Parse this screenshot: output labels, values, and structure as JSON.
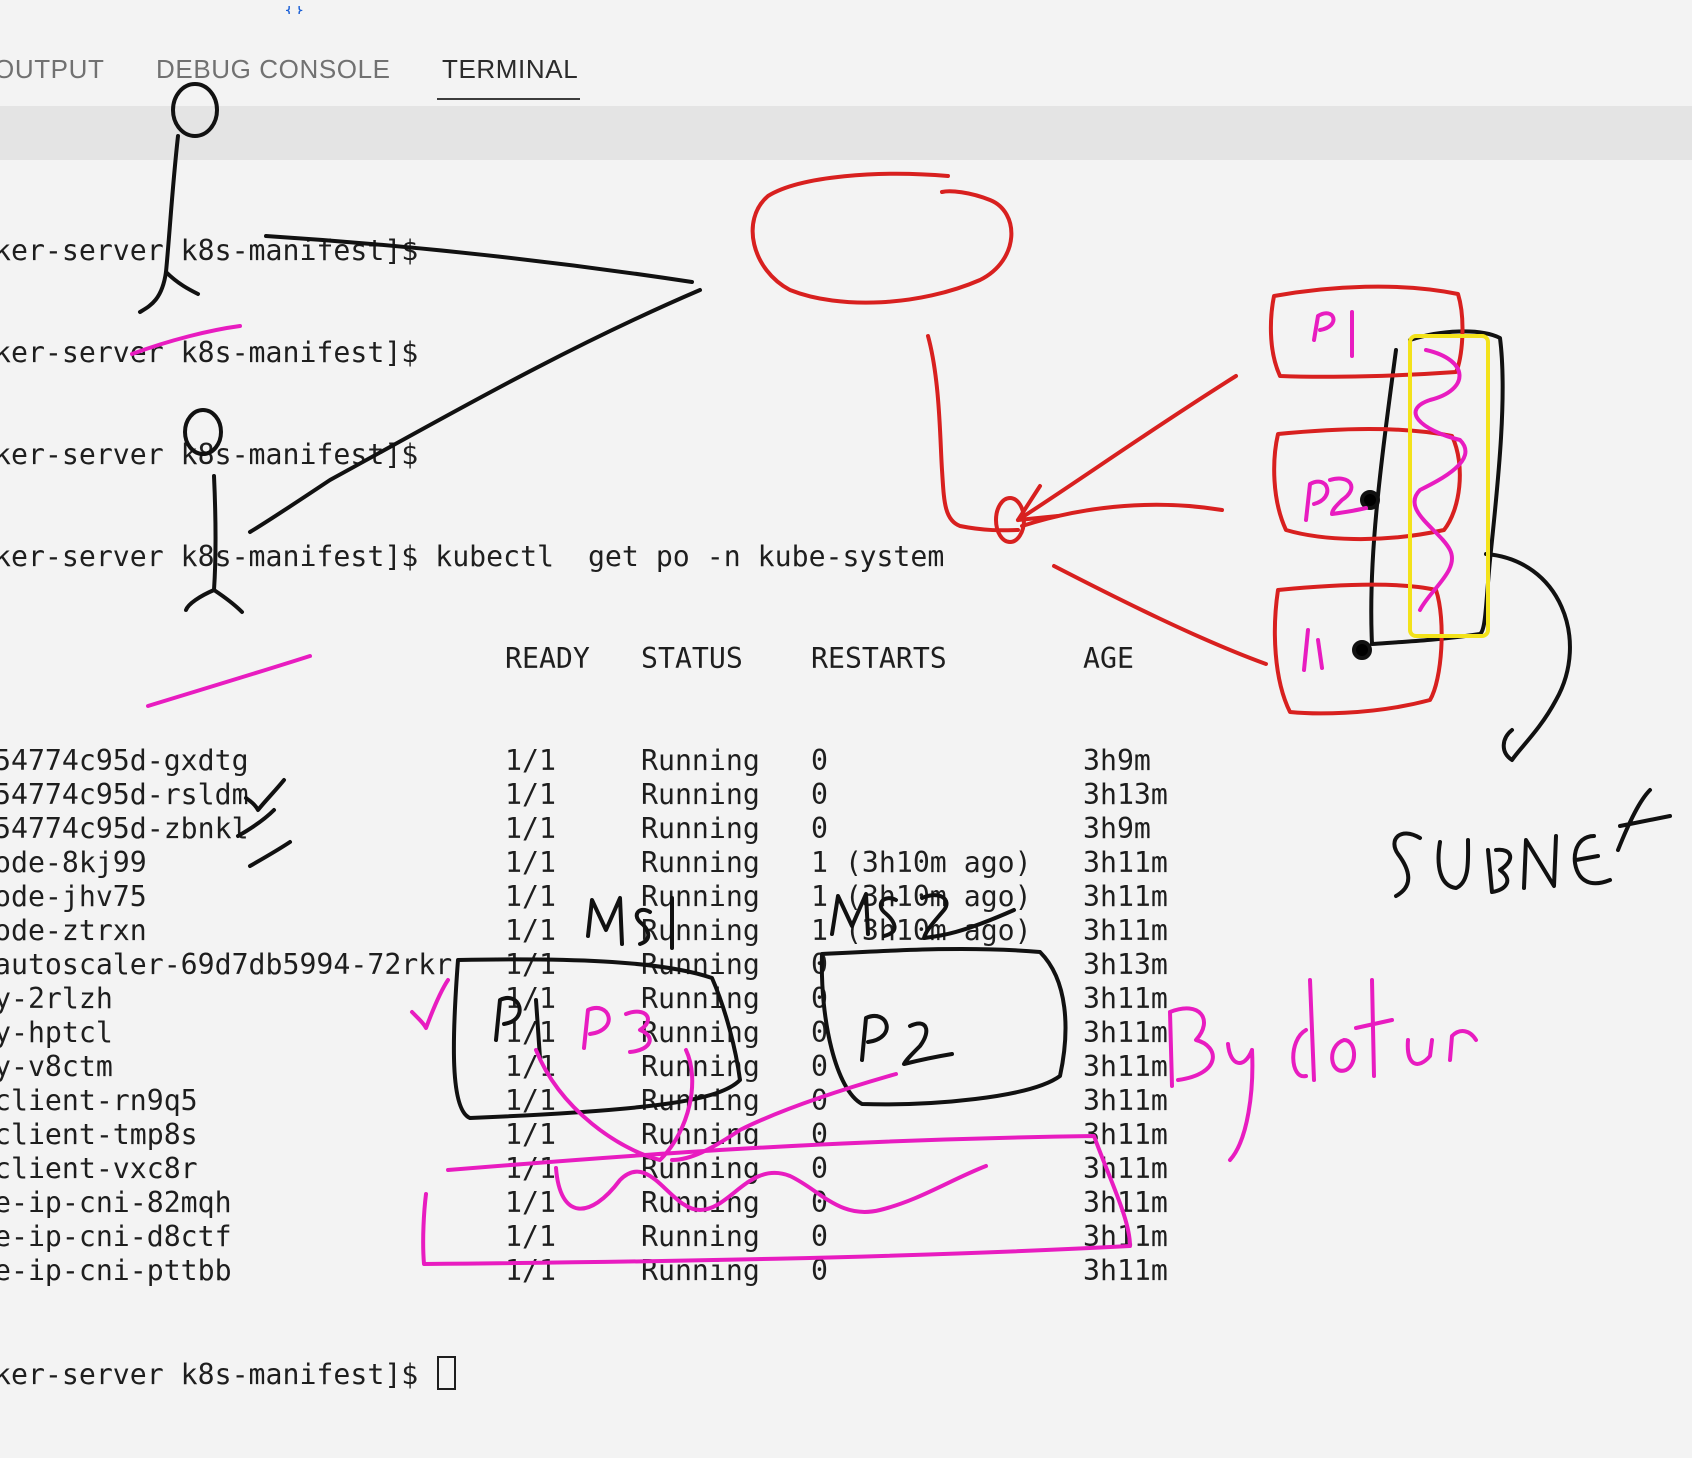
{
  "tabs": [
    {
      "label": "OUTPUT"
    },
    {
      "label": "DEBUG CONSOLE"
    },
    {
      "label": "TERMINAL",
      "active": true
    }
  ],
  "terminal": {
    "prompt_lines": [
      "ker-server k8s-manifest]$",
      "ker-server k8s-manifest]$",
      "ker-server k8s-manifest]$"
    ],
    "command_line": "ker-server k8s-manifest]$ kubectl  get po -n kube-system",
    "headers": {
      "ready": "READY",
      "status": "STATUS",
      "restarts": "RESTARTS",
      "age": "AGE"
    },
    "rows": [
      {
        "name": "54774c95d-gxdtg",
        "ready": "1/1",
        "status": "Running",
        "restarts": "0",
        "age": "3h9m"
      },
      {
        "name": "54774c95d-rsldm",
        "ready": "1/1",
        "status": "Running",
        "restarts": "0",
        "age": "3h13m"
      },
      {
        "name": "54774c95d-zbnkl",
        "ready": "1/1",
        "status": "Running",
        "restarts": "0",
        "age": "3h9m"
      },
      {
        "name": "ode-8kj99",
        "ready": "1/1",
        "status": "Running",
        "restarts": "1 (3h10m ago)",
        "age": "3h11m"
      },
      {
        "name": "ode-jhv75",
        "ready": "1/1",
        "status": "Running",
        "restarts": "1 (3h10m ago)",
        "age": "3h11m"
      },
      {
        "name": "ode-ztrxn",
        "ready": "1/1",
        "status": "Running",
        "restarts": "1 (3h10m ago)",
        "age": "3h11m"
      },
      {
        "name": "autoscaler-69d7db5994-72rkr",
        "ready": "1/1",
        "status": "Running",
        "restarts": "0",
        "age": "3h13m"
      },
      {
        "name": "y-2rlzh",
        "ready": "1/1",
        "status": "Running",
        "restarts": "0",
        "age": "3h11m"
      },
      {
        "name": "y-hptcl",
        "ready": "1/1",
        "status": "Running",
        "restarts": "0",
        "age": "3h11m"
      },
      {
        "name": "y-v8ctm",
        "ready": "1/1",
        "status": "Running",
        "restarts": "0",
        "age": "3h11m"
      },
      {
        "name": "client-rn9q5",
        "ready": "1/1",
        "status": "Running",
        "restarts": "0",
        "age": "3h11m"
      },
      {
        "name": "client-tmp8s",
        "ready": "1/1",
        "status": "Running",
        "restarts": "0",
        "age": "3h11m"
      },
      {
        "name": "client-vxc8r",
        "ready": "1/1",
        "status": "Running",
        "restarts": "0",
        "age": "3h11m"
      },
      {
        "name": "e-ip-cni-82mqh",
        "ready": "1/1",
        "status": "Running",
        "restarts": "0",
        "age": "3h11m"
      },
      {
        "name": "e-ip-cni-d8ctf",
        "ready": "1/1",
        "status": "Running",
        "restarts": "0",
        "age": "3h11m"
      },
      {
        "name": "e-ip-cni-pttbb",
        "ready": "1/1",
        "status": "Running",
        "restarts": "0",
        "age": "3h11m"
      }
    ],
    "final_prompt": "ker-server k8s-manifest]$"
  },
  "annotations": {
    "colors": {
      "black": "#111111",
      "red": "#d8201f",
      "magenta": "#e81cc0",
      "yellow": "#f3e21a"
    },
    "labels": {
      "node_p1": "P1",
      "node_p2": "P2",
      "node_p1_lower": "P1",
      "subnet": "SUBNET",
      "ms1": "MS1",
      "ms2": "MS2",
      "box_p1": "P1",
      "box_p3": "P3",
      "box_p2": "P2",
      "by_default": "By default"
    }
  }
}
